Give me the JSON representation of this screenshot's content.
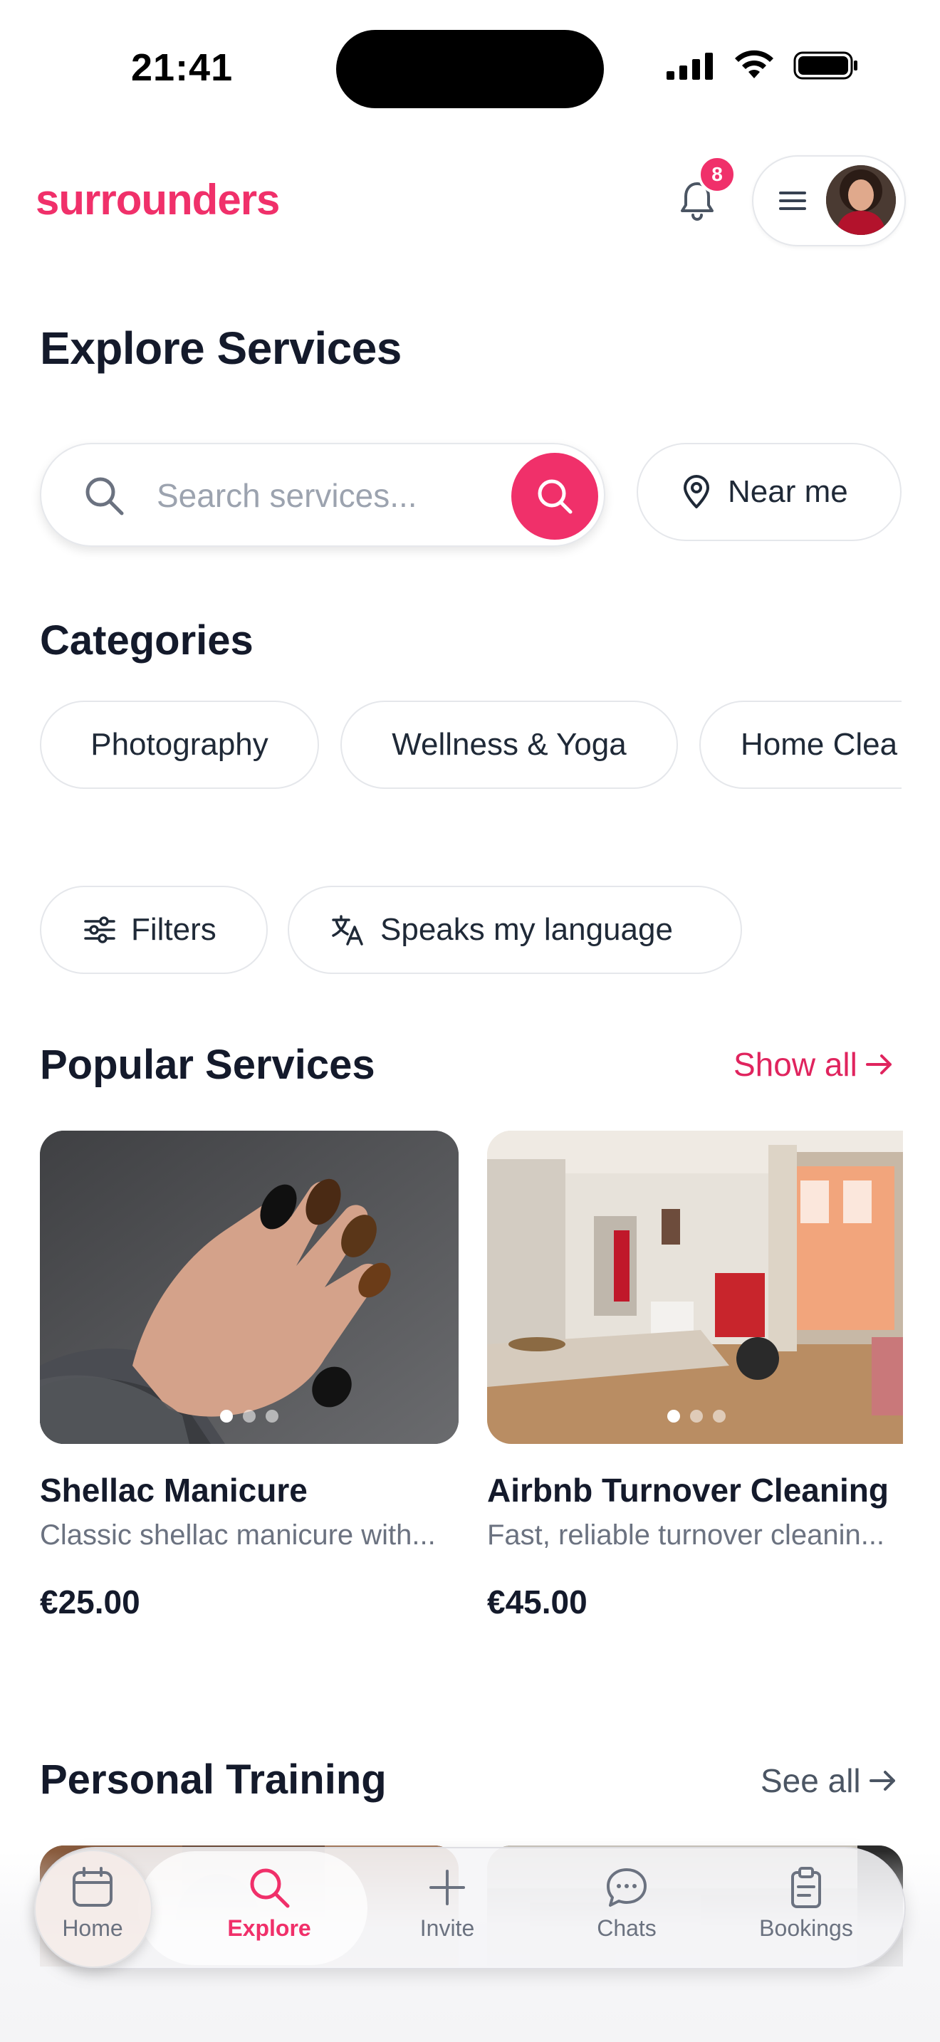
{
  "status_bar": {
    "time": "21:41"
  },
  "header": {
    "logo": "surrounders",
    "notification_count": "8"
  },
  "page_title": "Explore Services",
  "search": {
    "placeholder": "Search services...",
    "near_me_label": "Near me"
  },
  "categories": {
    "title": "Categories",
    "items": [
      "Photography",
      "Wellness & Yoga",
      "Home Clea"
    ]
  },
  "filters": {
    "filters_label": "Filters",
    "language_label": "Speaks my language"
  },
  "popular": {
    "title": "Popular Services",
    "show_all": "Show all",
    "cards": [
      {
        "title": "Shellac Manicure",
        "description": "Classic shellac manicure with...",
        "price": "€25.00"
      },
      {
        "title": "Airbnb Turnover Cleaning",
        "description": "Fast, reliable turnover cleanin...",
        "price": "€45.00"
      }
    ]
  },
  "personal_training": {
    "title": "Personal Training",
    "see_all": "See all"
  },
  "tab_bar": {
    "active": "Explore",
    "tabs": [
      {
        "label": "Home",
        "icon": "calendar-icon"
      },
      {
        "label": "Explore",
        "icon": "search-icon"
      },
      {
        "label": "Invite",
        "icon": "plus-icon"
      },
      {
        "label": "Chats",
        "icon": "chat-bubble-icon"
      },
      {
        "label": "Bookings",
        "icon": "clipboard-icon"
      }
    ]
  },
  "colors": {
    "brand": "#f0306a",
    "text": "#141a2b",
    "muted": "#6b7280"
  }
}
